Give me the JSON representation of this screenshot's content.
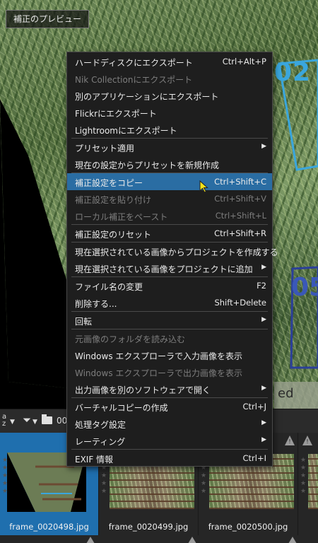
{
  "preview": {
    "label": "補正のプレビュー",
    "overlays": {
      "code_top": "02",
      "code_bottom": "05",
      "edge_text": "ed"
    }
  },
  "toolbar": {
    "sort_icon": "sort-az-icon",
    "sort_text": "a\nz",
    "filter_icon": "filter-icon",
    "folder_icon": "folder-icon",
    "folder_path": "00"
  },
  "thumbnails": [
    {
      "name": "frame_0020498.jpg",
      "selected": true
    },
    {
      "name": "frame_0020499.jpg",
      "selected": false
    },
    {
      "name": "frame_0020500.jpg",
      "selected": false
    },
    {
      "name": "",
      "selected": false
    }
  ],
  "menu": {
    "items": [
      {
        "label": "ハードディスクにエクスポート",
        "shortcut": "Ctrl+Alt+P"
      },
      {
        "label": "Nik Collectionにエクスポート",
        "shortcut": "",
        "disabled": true
      },
      {
        "label": "別のアプリケーションにエクスポート",
        "shortcut": ""
      },
      {
        "label": "Flickrにエクスポート",
        "shortcut": ""
      },
      {
        "label": "Lightroomにエクスポート",
        "shortcut": ""
      },
      {
        "label": "プリセット適用",
        "shortcut": "",
        "submenu": true
      },
      {
        "label": "現在の設定からプリセットを新規作成",
        "shortcut": ""
      },
      {
        "label": "補正設定をコピー",
        "shortcut": "Ctrl+Shift+C",
        "highlighted": true
      },
      {
        "label": "補正設定を貼り付け",
        "shortcut": "Ctrl+Shift+V",
        "disabled": true
      },
      {
        "label": "ローカル補正をペースト",
        "shortcut": "Ctrl+Shift+L",
        "disabled": true
      },
      {
        "label": "補正設定のリセット",
        "shortcut": "Ctrl+Shift+R"
      },
      {
        "label": "現在選択されている画像からプロジェクトを作成する",
        "shortcut": ""
      },
      {
        "label": "現在選択されている画像をプロジェクトに追加",
        "shortcut": "",
        "submenu": true
      },
      {
        "label": "ファイル名の変更",
        "shortcut": "F2"
      },
      {
        "label": "削除する...",
        "shortcut": "Shift+Delete"
      },
      {
        "label": "回転",
        "shortcut": "",
        "submenu": true
      },
      {
        "label": "元画像のフォルダを読み込む",
        "shortcut": "",
        "disabled": true
      },
      {
        "label": "Windows エクスプローラで入力画像を表示",
        "shortcut": ""
      },
      {
        "label": "Windows エクスプローラで出力画像を表示",
        "shortcut": "",
        "disabled": true
      },
      {
        "label": "出力画像を別のソフトウェアで開く",
        "shortcut": "",
        "submenu": true
      },
      {
        "label": "バーチャルコピーの作成",
        "shortcut": "Ctrl+J"
      },
      {
        "label": "処理タグ設定",
        "shortcut": "",
        "submenu": true
      },
      {
        "label": "レーティング",
        "shortcut": "",
        "submenu": true
      },
      {
        "label": "EXIF 情報",
        "shortcut": "Ctrl+I"
      }
    ]
  },
  "colors": {
    "highlight": "#2a6da3",
    "selected_thumb": "#1f6fae",
    "overlay_blue": "#3aa6dd"
  }
}
